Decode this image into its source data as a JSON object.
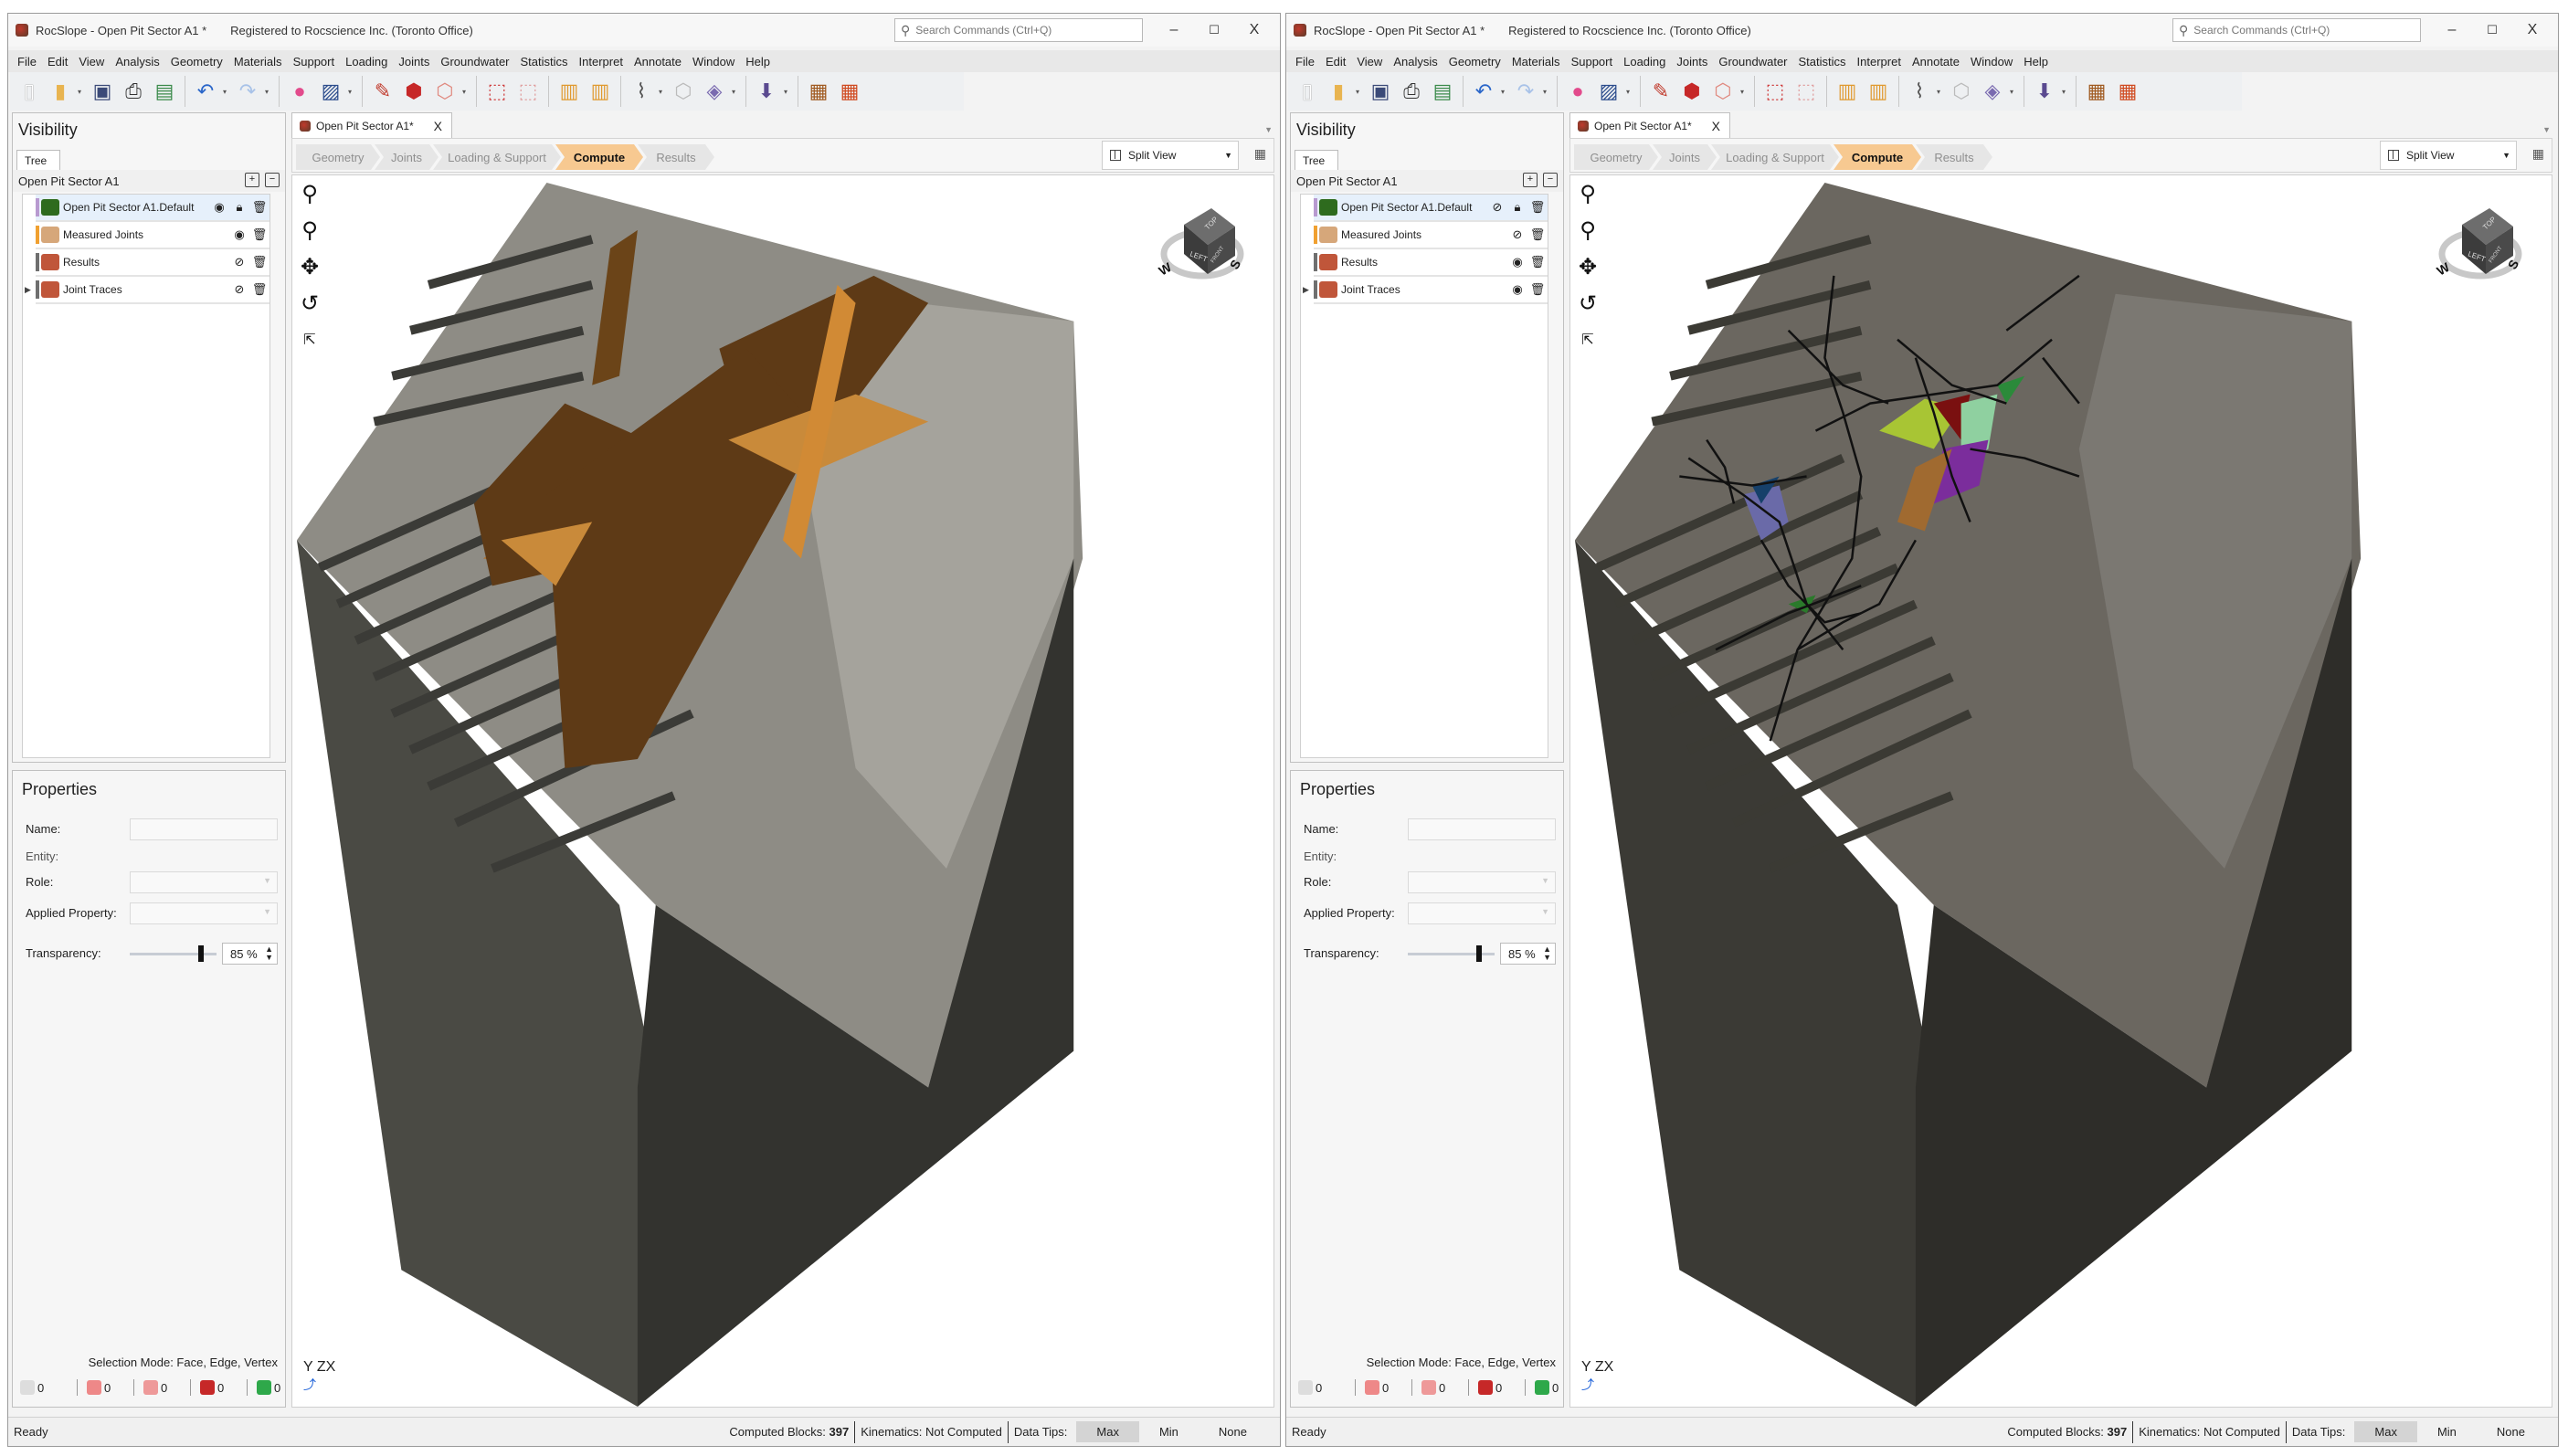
{
  "windows": [
    {
      "id": "left",
      "title": "RocSlope - Open Pit Sector A1 *",
      "registration": "Registered to Rocscience Inc. (Toronto Office)",
      "search_placeholder": "Search Commands (Ctrl+Q)",
      "window_controls": {
        "minimize": "–",
        "maximize": "☐",
        "close": "X"
      },
      "menu": [
        "File",
        "Edit",
        "View",
        "Analysis",
        "Geometry",
        "Materials",
        "Support",
        "Loading",
        "Joints",
        "Groundwater",
        "Statistics",
        "Interpret",
        "Annotate",
        "Window",
        "Help"
      ],
      "toolbar": [
        "new-icon",
        "open-icon",
        "save-icon",
        "print-icon",
        "export-icon",
        "undo-icon",
        "redo-icon",
        "color-wheel-icon",
        "image-icon",
        "edit-tool-icon",
        "red-block-icon",
        "wireframe-block-icon",
        "lock-select-icon",
        "clear-select-icon",
        "joint-set-icon",
        "joint-edit-icon",
        "trace-icon",
        "faded-block-icon",
        "probability-icon",
        "import-icon",
        "calculator-icon",
        "calculator-chart-icon"
      ],
      "visibility": {
        "title": "Visibility",
        "tab": "Tree",
        "root": "Open Pit Sector A1",
        "items": [
          {
            "label": "Open Pit Sector A1.Default",
            "visible": true,
            "locked": true,
            "selected": true,
            "bar_color": "#b89ad0",
            "icon": "terrain-icon"
          },
          {
            "label": "Measured Joints",
            "visible": true,
            "locked": false,
            "selected": false,
            "bar_color": "#f0a030",
            "icon": "measured-joints-icon"
          },
          {
            "label": "Results",
            "visible": false,
            "locked": false,
            "selected": false,
            "bar_color": "#6f6f6f",
            "icon": "results-icon"
          },
          {
            "label": "Joint Traces",
            "visible": false,
            "locked": false,
            "selected": false,
            "bar_color": "#6f6f6f",
            "icon": "joint-traces-icon",
            "expandable": true
          }
        ]
      },
      "properties": {
        "title": "Properties",
        "name_label": "Name:",
        "name_value": "",
        "entity_label": "Entity:",
        "role_label": "Role:",
        "role_value": "",
        "applied_label": "Applied Property:",
        "applied_value": "",
        "transparency_label": "Transparency:",
        "transparency_value": "85 %",
        "transparency_percent": 85
      },
      "selection_mode": "Selection Mode: Face, Edge, Vertex",
      "selection_counts": [
        "0",
        "0",
        "0",
        "0",
        "0"
      ],
      "doc_tab": "Open Pit Sector A1*",
      "doc_tab_close": "X",
      "workflow": [
        {
          "label": "Geometry"
        },
        {
          "label": "Joints"
        },
        {
          "label": "Loading & Support"
        },
        {
          "label": "Compute",
          "active": true
        },
        {
          "label": "Results"
        }
      ],
      "view_mode": "Split View",
      "viewport": {
        "scene": "joints",
        "cube_labels": {
          "top": "TOP",
          "left": "LEFT",
          "front": "FRONT"
        },
        "compass": {
          "w": "W",
          "s": "S"
        },
        "axis": "Y ZX"
      },
      "status": {
        "ready": "Ready",
        "computed_blocks_label": "Computed Blocks:",
        "computed_blocks": "397",
        "kinematics_label": "Kinematics:",
        "kinematics_value": "Not Computed",
        "data_tips_label": "Data Tips:",
        "data_tips": [
          "Max",
          "Min",
          "None"
        ],
        "data_tips_selected": "Max"
      }
    },
    {
      "id": "right",
      "title": "RocSlope - Open Pit Sector A1 *",
      "registration": "Registered to Rocscience Inc. (Toronto Office)",
      "search_placeholder": "Search Commands (Ctrl+Q)",
      "window_controls": {
        "minimize": "–",
        "maximize": "☐",
        "close": "X"
      },
      "menu": [
        "File",
        "Edit",
        "View",
        "Analysis",
        "Geometry",
        "Materials",
        "Support",
        "Loading",
        "Joints",
        "Groundwater",
        "Statistics",
        "Interpret",
        "Annotate",
        "Window",
        "Help"
      ],
      "toolbar": [
        "new-icon",
        "open-icon",
        "save-icon",
        "print-icon",
        "export-icon",
        "undo-icon",
        "redo-icon",
        "color-wheel-icon",
        "image-icon",
        "edit-tool-icon",
        "red-block-icon",
        "wireframe-block-icon",
        "lock-select-icon",
        "clear-select-icon",
        "joint-set-icon",
        "joint-edit-icon",
        "trace-icon",
        "faded-block-icon",
        "probability-icon",
        "import-icon",
        "calculator-icon",
        "calculator-chart-icon"
      ],
      "visibility": {
        "title": "Visibility",
        "tab": "Tree",
        "root": "Open Pit Sector A1",
        "items": [
          {
            "label": "Open Pit Sector A1.Default",
            "visible": false,
            "locked": true,
            "selected": true,
            "bar_color": "#b89ad0",
            "icon": "terrain-icon"
          },
          {
            "label": "Measured Joints",
            "visible": false,
            "locked": false,
            "selected": false,
            "bar_color": "#f0a030",
            "icon": "measured-joints-icon"
          },
          {
            "label": "Results",
            "visible": true,
            "locked": false,
            "selected": false,
            "bar_color": "#6f6f6f",
            "icon": "results-icon"
          },
          {
            "label": "Joint Traces",
            "visible": true,
            "locked": false,
            "selected": false,
            "bar_color": "#6f6f6f",
            "icon": "joint-traces-icon",
            "expandable": true
          }
        ]
      },
      "properties": {
        "title": "Properties",
        "name_label": "Name:",
        "name_value": "",
        "entity_label": "Entity:",
        "role_label": "Role:",
        "role_value": "",
        "applied_label": "Applied Property:",
        "applied_value": "",
        "transparency_label": "Transparency:",
        "transparency_value": "85 %",
        "transparency_percent": 85
      },
      "selection_mode": "Selection Mode: Face, Edge, Vertex",
      "selection_counts": [
        "0",
        "0",
        "0",
        "0",
        "0"
      ],
      "doc_tab": "Open Pit Sector A1*",
      "doc_tab_close": "X",
      "workflow": [
        {
          "label": "Geometry"
        },
        {
          "label": "Joints"
        },
        {
          "label": "Loading & Support"
        },
        {
          "label": "Compute",
          "active": true
        },
        {
          "label": "Results"
        }
      ],
      "view_mode": "Split View",
      "viewport": {
        "scene": "traces",
        "cube_labels": {
          "top": "TOP",
          "left": "LEFT",
          "front": "FRONT"
        },
        "compass": {
          "w": "W",
          "s": "S"
        },
        "axis": "Y ZX"
      },
      "status": {
        "ready": "Ready",
        "computed_blocks_label": "Computed Blocks:",
        "computed_blocks": "397",
        "kinematics_label": "Kinematics:",
        "kinematics_value": "Not Computed",
        "data_tips_label": "Data Tips:",
        "data_tips": [
          "Max",
          "Min",
          "None"
        ],
        "data_tips_selected": "Max"
      }
    }
  ],
  "colors": {
    "compute_active": "#f7c991",
    "terrain_top_light": "#9a9890",
    "terrain_side_dark": "#3a3a35",
    "joint_plane_dark": "#5e3a16",
    "joint_plane_light": "#c47f2e",
    "trace_line": "#111111"
  }
}
